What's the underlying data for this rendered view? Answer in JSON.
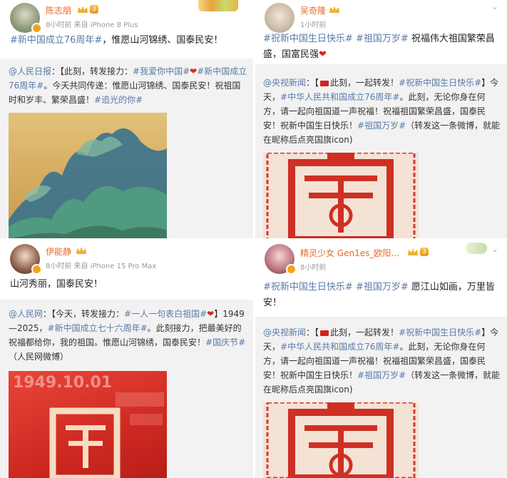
{
  "posts": [
    {
      "user": "陈志朋",
      "meta": "8小时前  来自 iPhone 8 Plus",
      "level": "3",
      "text": [
        "#新中国成立76周年#",
        "，惟愿山河锦绣、国泰民安！"
      ],
      "repost": {
        "author": "@人民日报",
        "body": [
          "：【此刻，转发接力：",
          "#我爱你中国#",
          "❤",
          "",
          "#新中国成立76周年#",
          "。今天共同传递：惟愿山河锦绣、国泰民安！祝祖国时和岁丰、繁荣昌盛！",
          "#追光的你#"
        ]
      },
      "image": "blue-green-mountains-painting"
    },
    {
      "user": "吴奇隆",
      "meta": "1小时前",
      "level": "",
      "text": [
        "#祝新中国生日快乐#",
        " ",
        "#祖国万岁#",
        " 祝福伟大祖国繁荣昌盛，国富民强",
        "❤"
      ],
      "repost": {
        "author": "@央视新闻",
        "body": [
          "：【",
          "此刻，一起转发！",
          "#祝新中国生日快乐#",
          "】今天，",
          "#中华人民共和国成立76周年#",
          "。此刻，无论你身在何方，请一起向祖国道一声祝福！祝福祖国繁荣昌盛，国泰民安！祝新中国生日快乐！",
          "#祖国万岁#",
          "（转发这一条微博，就能在昵称后点亮国旗icon)"
        ]
      },
      "image": "red-papercut-guo"
    },
    {
      "user": "伊能静",
      "meta": "8小时前  来自 iPhone 15 Pro Max",
      "level": "",
      "text": [
        "山河秀丽，国泰民安！"
      ],
      "repost": {
        "author": "@人民网",
        "body": [
          "：【今天，转发接力：",
          "#一人一句表白祖国#",
          "❤",
          "】1949—2025，",
          "#新中国成立七十六周年#",
          "。此刻接力，把最美好的祝福都给你，我的祖国。惟愿山河锦绣，国泰民安！",
          "#国庆节#",
          "（人民网微博）"
        ]
      },
      "image": "red-1949-10-01-guo",
      "image_text": "1949.10.01"
    },
    {
      "user": "精灵少女 Gen1es_欧阳...",
      "meta": "8小时前",
      "level": "3",
      "text": [
        "#祝新中国生日快乐#",
        " ",
        "#祖国万岁#",
        " 愿江山如画，万里皆安！"
      ],
      "repost": {
        "author": "@央视新闻",
        "body": [
          "：【",
          "此刻，一起转发！",
          "#祝新中国生日快乐#",
          "】今天，",
          "#中华人民共和国成立76周年#",
          "。此刻，无论你身在何方，请一起向祖国道一声祝福！祝福祖国繁荣昌盛，国泰民安！祝新中国生日快乐！",
          "#祖国万岁#",
          "（转发这一条微博，就能在昵称后点亮国旗icon)"
        ]
      },
      "image": "red-papercut-guo"
    }
  ]
}
